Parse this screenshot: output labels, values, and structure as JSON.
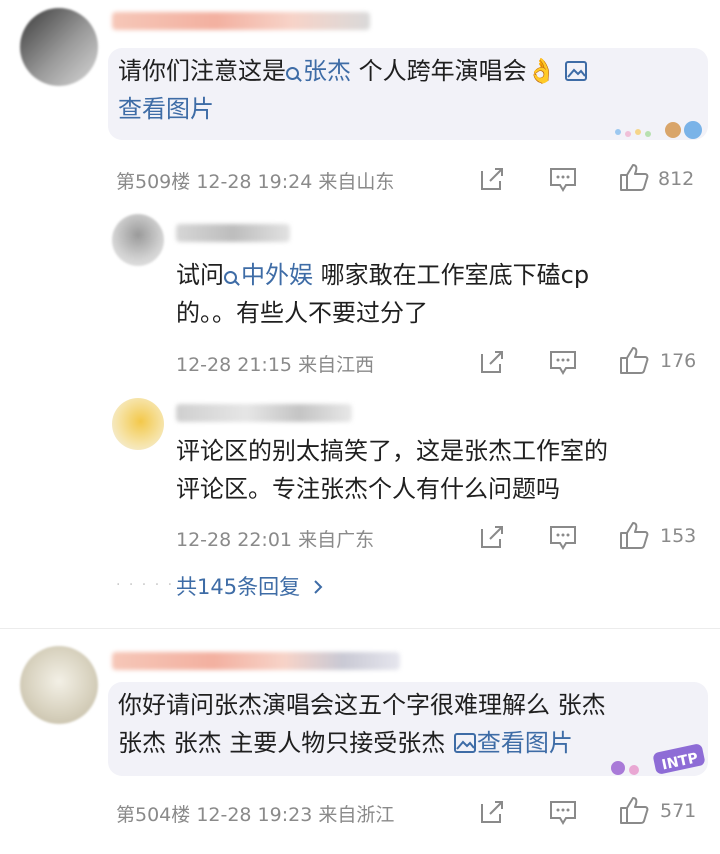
{
  "comments": [
    {
      "text_before_topic": "请你们注意这是",
      "topic": "张杰",
      "text_after_topic": " 个人跨年演唱会👌",
      "image_link": "查看图片",
      "floor": "第509楼",
      "time": "12-28 19:24",
      "location": "来自山东",
      "likes": "812"
    },
    {
      "text_before_topic": "你好请问张杰演唱会这五个字很难理解么 张杰",
      "line2": "张杰 张杰 主要人物只接受张杰 ",
      "image_link": "查看图片",
      "floor": "第504楼",
      "time": "12-28 19:23",
      "location": "来自浙江",
      "likes": "571"
    }
  ],
  "replies": [
    {
      "text_before_topic": "试问",
      "topic": "中外娱",
      "text_after_topic": " 哪家敢在工作室底下磕cp",
      "line2": "的。。有些人不要过分了",
      "time": "12-28 21:15",
      "location": "来自江西",
      "likes": "176"
    },
    {
      "line1": "评论区的别太搞笑了，这是张杰工作室的",
      "line2": "评论区。专注张杰个人有什么问题吗",
      "time": "12-28 22:01",
      "location": "来自广东",
      "likes": "153"
    }
  ],
  "more_replies": "共145条回复",
  "icons": {
    "share": "share-icon",
    "comment": "comment-icon",
    "like": "thumbs-up-icon",
    "image": "image-icon",
    "search": "search-icon"
  },
  "colors": {
    "link": "#3e6ca6",
    "meta": "#8a8a8a",
    "bubble": "#f2f2f8"
  }
}
